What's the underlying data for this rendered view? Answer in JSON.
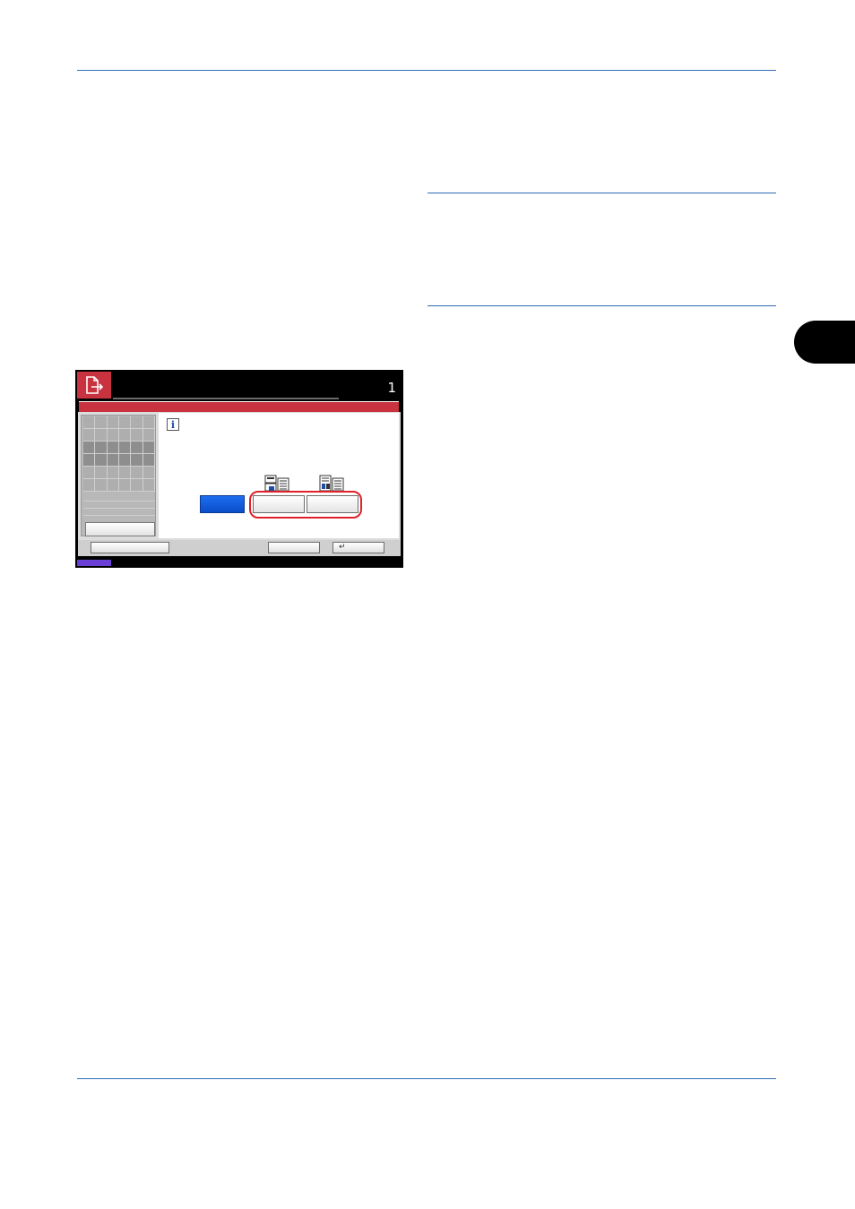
{
  "page": {
    "chapter_tab_label": ""
  },
  "panel": {
    "title": "",
    "count": "1",
    "icons": {
      "header": "document-output-icon",
      "info": "info-icon",
      "option_left": "layout-image-left-icon",
      "option_right": "layout-image-right-icon",
      "enter": "enter-icon"
    },
    "info_glyph": "i",
    "buttons": {
      "off": "",
      "option1": "",
      "option2": "",
      "left_action": "",
      "footer_left": "",
      "footer_mid": "",
      "footer_ok": "↵"
    },
    "colors": {
      "accent": "#c8333f",
      "selected": "#0a4cc8",
      "highlight": "#e0202a",
      "status": "#6a3fd6"
    }
  }
}
